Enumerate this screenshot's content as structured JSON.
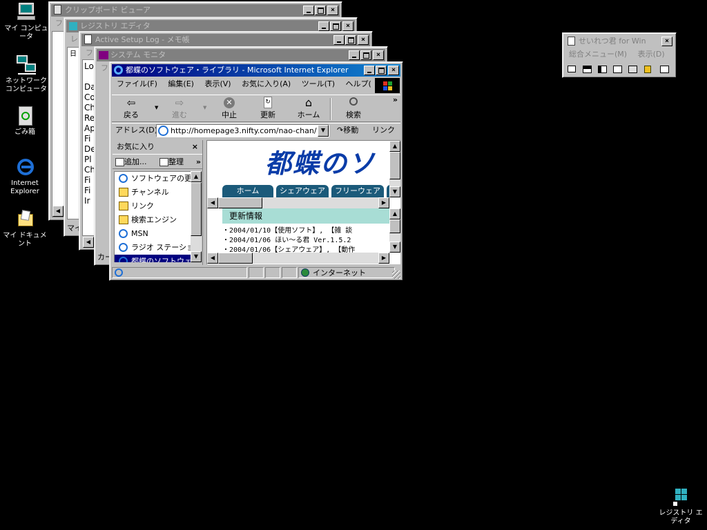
{
  "desktop": {
    "icons": [
      {
        "label": "マイ コンピュータ",
        "icon": "my-computer-icon"
      },
      {
        "label": "ネットワーク\nコンピュータ",
        "icon": "network-computer-icon"
      },
      {
        "label": "ごみ箱",
        "icon": "recycle-bin-icon"
      },
      {
        "label": "Internet\nExplorer",
        "icon": "internet-explorer-icon"
      },
      {
        "label": "マイ ドキュメント",
        "icon": "my-documents-icon"
      }
    ],
    "corner_icon": {
      "label": "レジストリ エディタ",
      "icon": "registry-editor-icon"
    }
  },
  "windows": {
    "clipboard": {
      "title": "クリップボード ビューア",
      "menu_fragment": "ファ"
    },
    "regedit": {
      "title": "レジストリ エディタ",
      "menu_fragment": "レ",
      "tree_fragment": "日",
      "status_fragment": "マイ"
    },
    "notepad": {
      "title": "Active Setup Log - メモ帳",
      "menu_fragment": "ファ",
      "lines": [
        "Lo",
        "",
        "Da",
        "Co",
        "Ch",
        "Re",
        "Ap",
        "Fi",
        "De",
        "Pl",
        "Ch",
        "Fi",
        "Fi",
        "Ir"
      ]
    },
    "sysmon": {
      "title": "システム モニタ",
      "menu_fragment": "ファ",
      "status_fragment": "カー"
    }
  },
  "ie": {
    "title": "都蝶のソフトウェア・ライブラリ - Microsoft Internet Explorer",
    "menu": [
      "ファイル(F)",
      "編集(E)",
      "表示(V)",
      "お気に入り(A)",
      "ツール(T)",
      "ヘルプ("
    ],
    "toolbar": {
      "back": "戻る",
      "forward": "進む",
      "stop": "中止",
      "refresh": "更新",
      "home": "ホーム",
      "search": "検索",
      "more": "»"
    },
    "address": {
      "label": "アドレス(D)",
      "url": "http://homepage3.nifty.com/nao-chan/",
      "go": "移動",
      "links": "リンク",
      "more": "»"
    },
    "favorites": {
      "header": "お気に入り",
      "close": "×",
      "add": "追加...",
      "organize": "整理",
      "more": "»",
      "items": [
        {
          "label": "ソフトウェアの更...",
          "kind": "page"
        },
        {
          "label": "チャンネル",
          "kind": "folder"
        },
        {
          "label": "リンク",
          "kind": "folder"
        },
        {
          "label": "検索エンジン",
          "kind": "folder"
        },
        {
          "label": "MSN",
          "kind": "page"
        },
        {
          "label": "ラジオ ステーショ...",
          "kind": "page"
        },
        {
          "label": "都蝶のソフトウェ...",
          "kind": "page"
        }
      ]
    },
    "page": {
      "heading": "都蝶のソ",
      "tabs": [
        "ホーム",
        "シェアウェア",
        "フリーウェア"
      ],
      "news_header": "更新情報",
      "news": [
        "・2004/01/10【使用ソフト】, 【雑 談",
        "・2004/01/06 ほい～る君 Ver.1.5.2",
        "・2004/01/06【シェアウェア】, 【動作"
      ]
    },
    "status": {
      "zone": "インターネット"
    }
  },
  "seireki": {
    "title": "せいれつ君 for Win",
    "menu": [
      "総合メニュー(M)",
      "表示(D)"
    ]
  },
  "colors": {
    "desktop": "#000000",
    "active_title": "#000080",
    "inactive_title": "#808080",
    "heading": "#0a3ca8",
    "news_header": "#a8ddd5",
    "tab": "#1b5a7a"
  }
}
